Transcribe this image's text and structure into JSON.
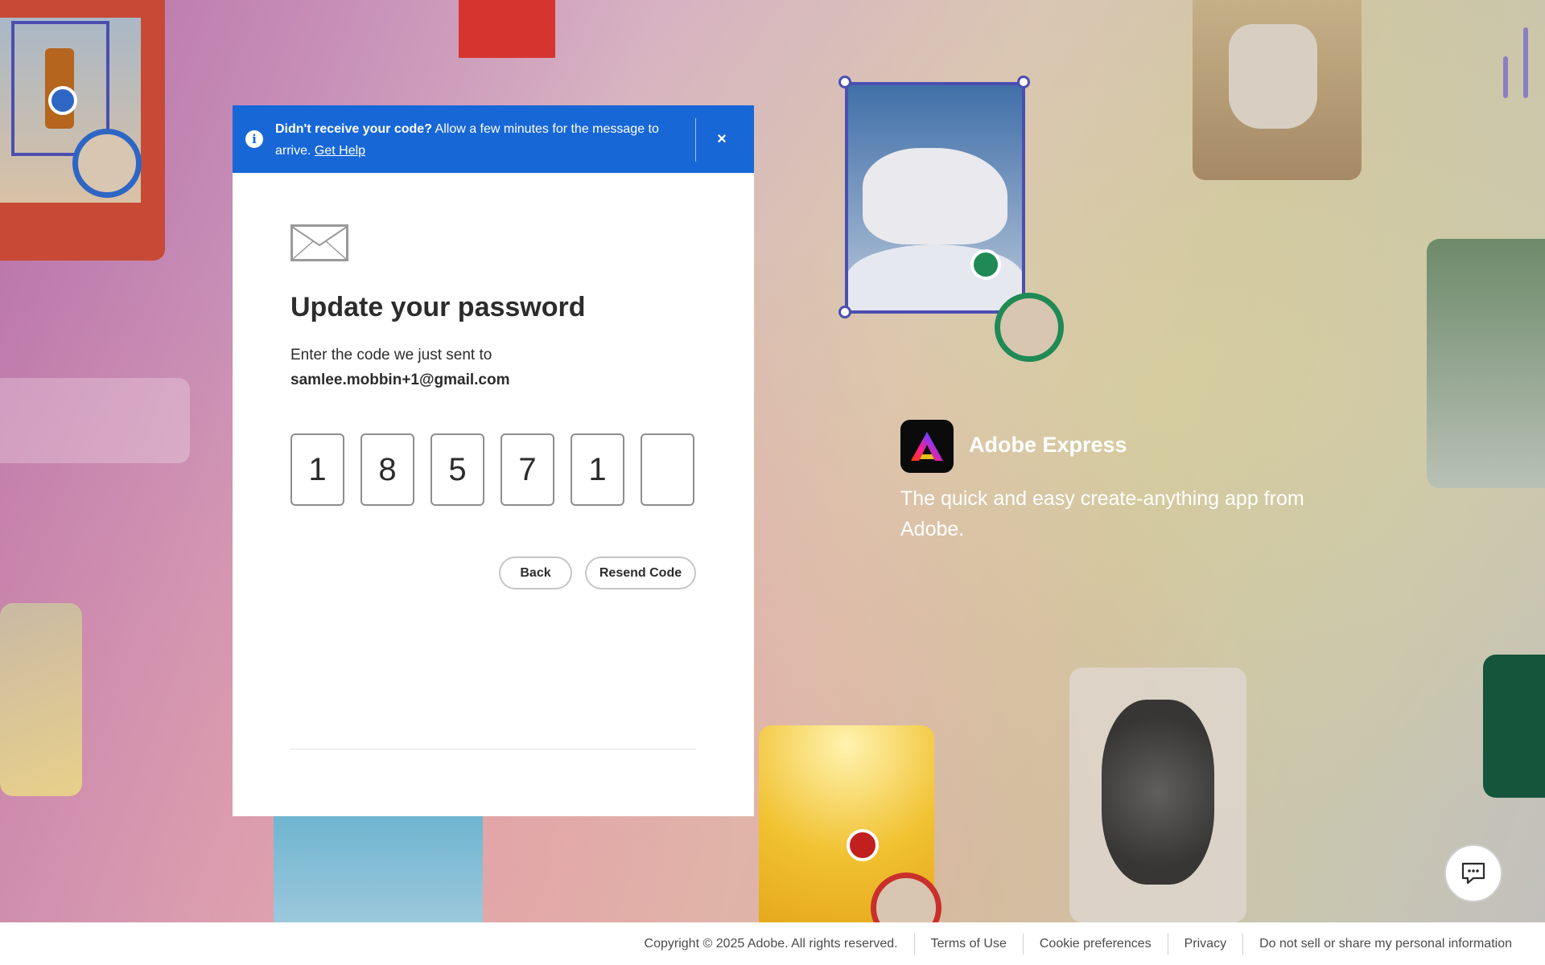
{
  "toast": {
    "bold": "Didn't receive your code?",
    "text": " Allow a few minutes for the message to arrive. ",
    "link": "Get Help",
    "close": "×"
  },
  "dialog": {
    "title": "Update your password",
    "subtitle": "Enter the code we just sent to",
    "email": "samlee.mobbin+1@gmail.com",
    "code_digits": [
      "1",
      "8",
      "5",
      "7",
      "1",
      ""
    ],
    "back_label": "Back",
    "resend_label": "Resend Code"
  },
  "brand": {
    "name": "Adobe Express",
    "tagline": "The quick and easy create-anything app from Adobe."
  },
  "footer": {
    "copyright": "Copyright © 2025 Adobe. All rights reserved.",
    "terms": "Terms of Use",
    "cookies": "Cookie preferences",
    "privacy": "Privacy",
    "do_not_sell": "Do not sell or share my personal information"
  },
  "colors": {
    "toast_bg": "#1867d7",
    "dialog_bg": "#ffffff"
  },
  "icons": {
    "info": "info-icon",
    "close": "close-icon",
    "mail": "envelope-icon",
    "chat": "chat-bubble-icon",
    "logo": "adobe-express-logo"
  }
}
